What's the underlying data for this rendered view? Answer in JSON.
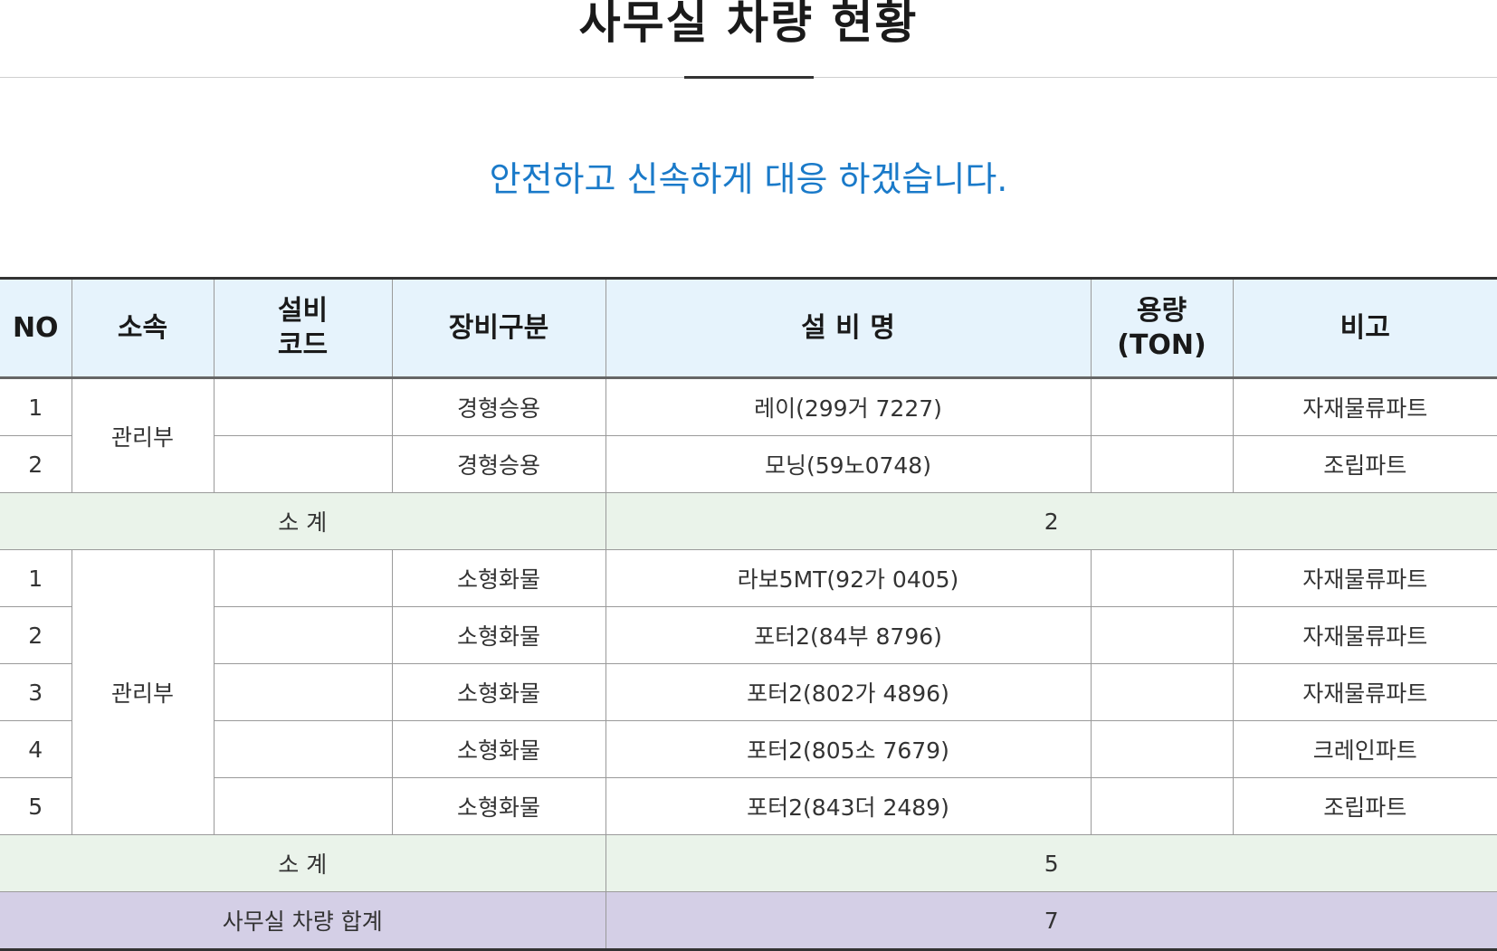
{
  "page": {
    "title": "사무실 차량 현황",
    "subtitle": "안전하고 신속하게 대응 하겠습니다."
  },
  "table": {
    "headers": {
      "no": "NO",
      "dept": "소속",
      "code_line1": "설비",
      "code_line2": "코드",
      "category": "장비구분",
      "name": "설 비 명",
      "capacity_line1": "용량",
      "capacity_line2": "(TON)",
      "note": "비고"
    },
    "groups": [
      {
        "dept": "관리부",
        "rows": [
          {
            "no": "1",
            "code": "",
            "category": "경형승용",
            "name": "레이(299거 7227)",
            "capacity": "",
            "note": "자재물류파트"
          },
          {
            "no": "2",
            "code": "",
            "category": "경형승용",
            "name": "모닝(59노0748)",
            "capacity": "",
            "note": "조립파트"
          }
        ],
        "subtotal_label": "소 계",
        "subtotal_value": "2"
      },
      {
        "dept": "관리부",
        "rows": [
          {
            "no": "1",
            "code": "",
            "category": "소형화물",
            "name": "라보5MT(92가 0405)",
            "capacity": "",
            "note": "자재물류파트"
          },
          {
            "no": "2",
            "code": "",
            "category": "소형화물",
            "name": "포터2(84부 8796)",
            "capacity": "",
            "note": "자재물류파트"
          },
          {
            "no": "3",
            "code": "",
            "category": "소형화물",
            "name": "포터2(802가 4896)",
            "capacity": "",
            "note": "자재물류파트"
          },
          {
            "no": "4",
            "code": "",
            "category": "소형화물",
            "name": "포터2(805소 7679)",
            "capacity": "",
            "note": "크레인파트"
          },
          {
            "no": "5",
            "code": "",
            "category": "소형화물",
            "name": "포터2(843더 2489)",
            "capacity": "",
            "note": "조립파트"
          }
        ],
        "subtotal_label": "소 계",
        "subtotal_value": "5"
      }
    ],
    "total_label": "사무실 차량 합계",
    "total_value": "7"
  },
  "colors": {
    "header_bg": "#e6f3fc",
    "subtotal_bg": "#eaf3ea",
    "total_bg": "#d4cfe6",
    "subtitle": "#1a7ac9"
  }
}
